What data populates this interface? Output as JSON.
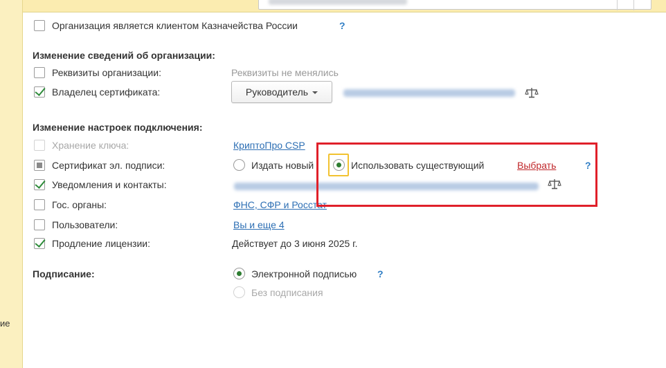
{
  "side": {
    "fragment": "ие"
  },
  "top_checkbox": {
    "label": "Организация является клиентом Казначейства России",
    "help": "?"
  },
  "org_changes": {
    "title": "Изменение сведений об организации:",
    "requisites": {
      "label": "Реквизиты организации:",
      "value": "Реквизиты не менялись"
    },
    "owner": {
      "label": "Владелец сертификата:",
      "button": "Руководитель"
    }
  },
  "conn_changes": {
    "title": "Изменение настроек подключения:",
    "key_storage": {
      "label": "Хранение ключа:",
      "link": "КриптоПро CSP"
    },
    "certificate": {
      "label": "Сертификат эл. подписи:",
      "option_new": "Издать новый",
      "option_existing": "Использовать существующий",
      "choose_link": "Выбрать",
      "help": "?"
    },
    "notifications": {
      "label": "Уведомления и контакты:"
    },
    "gov": {
      "label": "Гос. органы:",
      "link": "ФНС, СФР и Росстат"
    },
    "users": {
      "label": "Пользователи:",
      "link": "Вы и еще 4"
    },
    "license": {
      "label": "Продление лицензии:",
      "value": "Действует до 3 июня 2025 г."
    }
  },
  "signing": {
    "title": "Подписание:",
    "option_electronic": "Электронной подписью",
    "option_none": "Без подписания",
    "help": "?"
  },
  "colors": {
    "highlight_box": "#e0202a",
    "focus": "#f2c230",
    "link": "#2d6fb4",
    "check": "#2e8b3a"
  }
}
